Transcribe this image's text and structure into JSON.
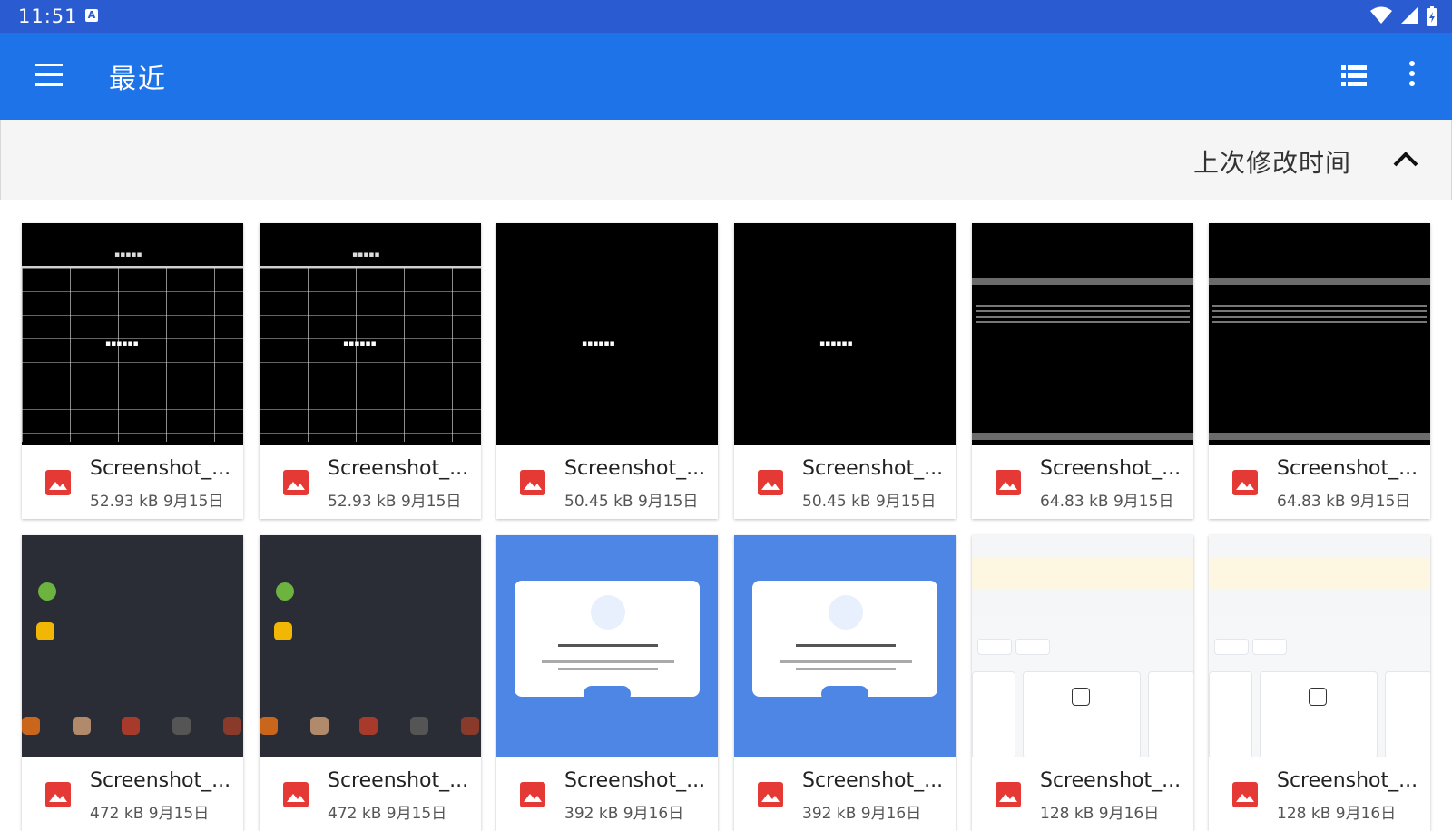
{
  "status_bar": {
    "time": "11:51",
    "notification_icon": "A"
  },
  "app_bar": {
    "title": "最近",
    "menu_icon": "hamburger-menu-icon",
    "view_icon": "list-view-icon",
    "more_icon": "more-vert-icon"
  },
  "sort_bar": {
    "label": "上次修改时间",
    "direction_icon": "chevron-up-icon"
  },
  "files": [
    {
      "name": "Screenshot_...",
      "size": "52.93 kB",
      "date": "9月15日",
      "thumb": "grid"
    },
    {
      "name": "Screenshot_...",
      "size": "52.93 kB",
      "date": "9月15日",
      "thumb": "grid"
    },
    {
      "name": "Screenshot_...",
      "size": "50.45 kB",
      "date": "9月15日",
      "thumb": "black"
    },
    {
      "name": "Screenshot_...",
      "size": "50.45 kB",
      "date": "9月15日",
      "thumb": "black"
    },
    {
      "name": "Screenshot_...",
      "size": "64.83 kB",
      "date": "9月15日",
      "thumb": "text"
    },
    {
      "name": "Screenshot_...",
      "size": "64.83 kB",
      "date": "9月15日",
      "thumb": "text"
    },
    {
      "name": "Screenshot_...",
      "size": "472 kB",
      "date": "9月15日",
      "thumb": "home"
    },
    {
      "name": "Screenshot_...",
      "size": "472 kB",
      "date": "9月15日",
      "thumb": "home"
    },
    {
      "name": "Screenshot_...",
      "size": "392 kB",
      "date": "9月16日",
      "thumb": "dialog"
    },
    {
      "name": "Screenshot_...",
      "size": "392 kB",
      "date": "9月16日",
      "thumb": "dialog"
    },
    {
      "name": "Screenshot_...",
      "size": "128 kB",
      "date": "9月16日",
      "thumb": "store"
    },
    {
      "name": "Screenshot_...",
      "size": "128 kB",
      "date": "9月16日",
      "thumb": "store"
    }
  ],
  "colors": {
    "status_bar": "#2a5bd0",
    "app_bar": "#1f73e8",
    "image_icon": "#e53935"
  }
}
